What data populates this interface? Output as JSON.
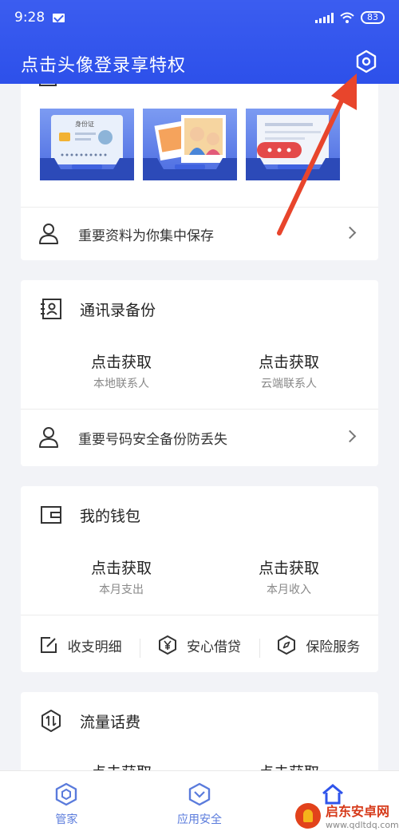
{
  "status_bar": {
    "time": "9:28",
    "battery": "83"
  },
  "header": {
    "title": "点击头像登录享特权"
  },
  "documents_card": {
    "thumbnails": [
      "id-card-illustration",
      "photo-album-illustration",
      "chat-document-illustration"
    ],
    "id_card_text": "身份证",
    "link_label": "重要资料为你集中保存"
  },
  "contacts_card": {
    "title": "通讯录备份",
    "stats": [
      {
        "value": "点击获取",
        "caption": "本地联系人"
      },
      {
        "value": "点击获取",
        "caption": "云端联系人"
      }
    ],
    "link_label": "重要号码安全备份防丢失"
  },
  "wallet_card": {
    "title": "我的钱包",
    "stats": [
      {
        "value": "点击获取",
        "caption": "本月支出"
      },
      {
        "value": "点击获取",
        "caption": "本月收入"
      }
    ],
    "actions": [
      {
        "label": "收支明细",
        "icon": "edit-icon"
      },
      {
        "label": "安心借贷",
        "icon": "yuan-hexagon-icon"
      },
      {
        "label": "保险服务",
        "icon": "compass-hexagon-icon"
      }
    ]
  },
  "traffic_card": {
    "title": "流量话费",
    "stats": [
      {
        "value": "点击获取"
      },
      {
        "value": "点击获取"
      }
    ]
  },
  "tabbar": {
    "tabs": [
      {
        "label": "管家",
        "icon": "hexagon-icon"
      },
      {
        "label": "应用安全",
        "icon": "shield-icon"
      },
      {
        "label": "",
        "icon": "home-icon"
      }
    ]
  },
  "watermark": {
    "name": "启东安卓网",
    "url": "www.qdltdq.com"
  },
  "colors": {
    "primary": "#2f54eb",
    "arrow": "#e8452c",
    "tab_icon": "#5a7bdc"
  }
}
